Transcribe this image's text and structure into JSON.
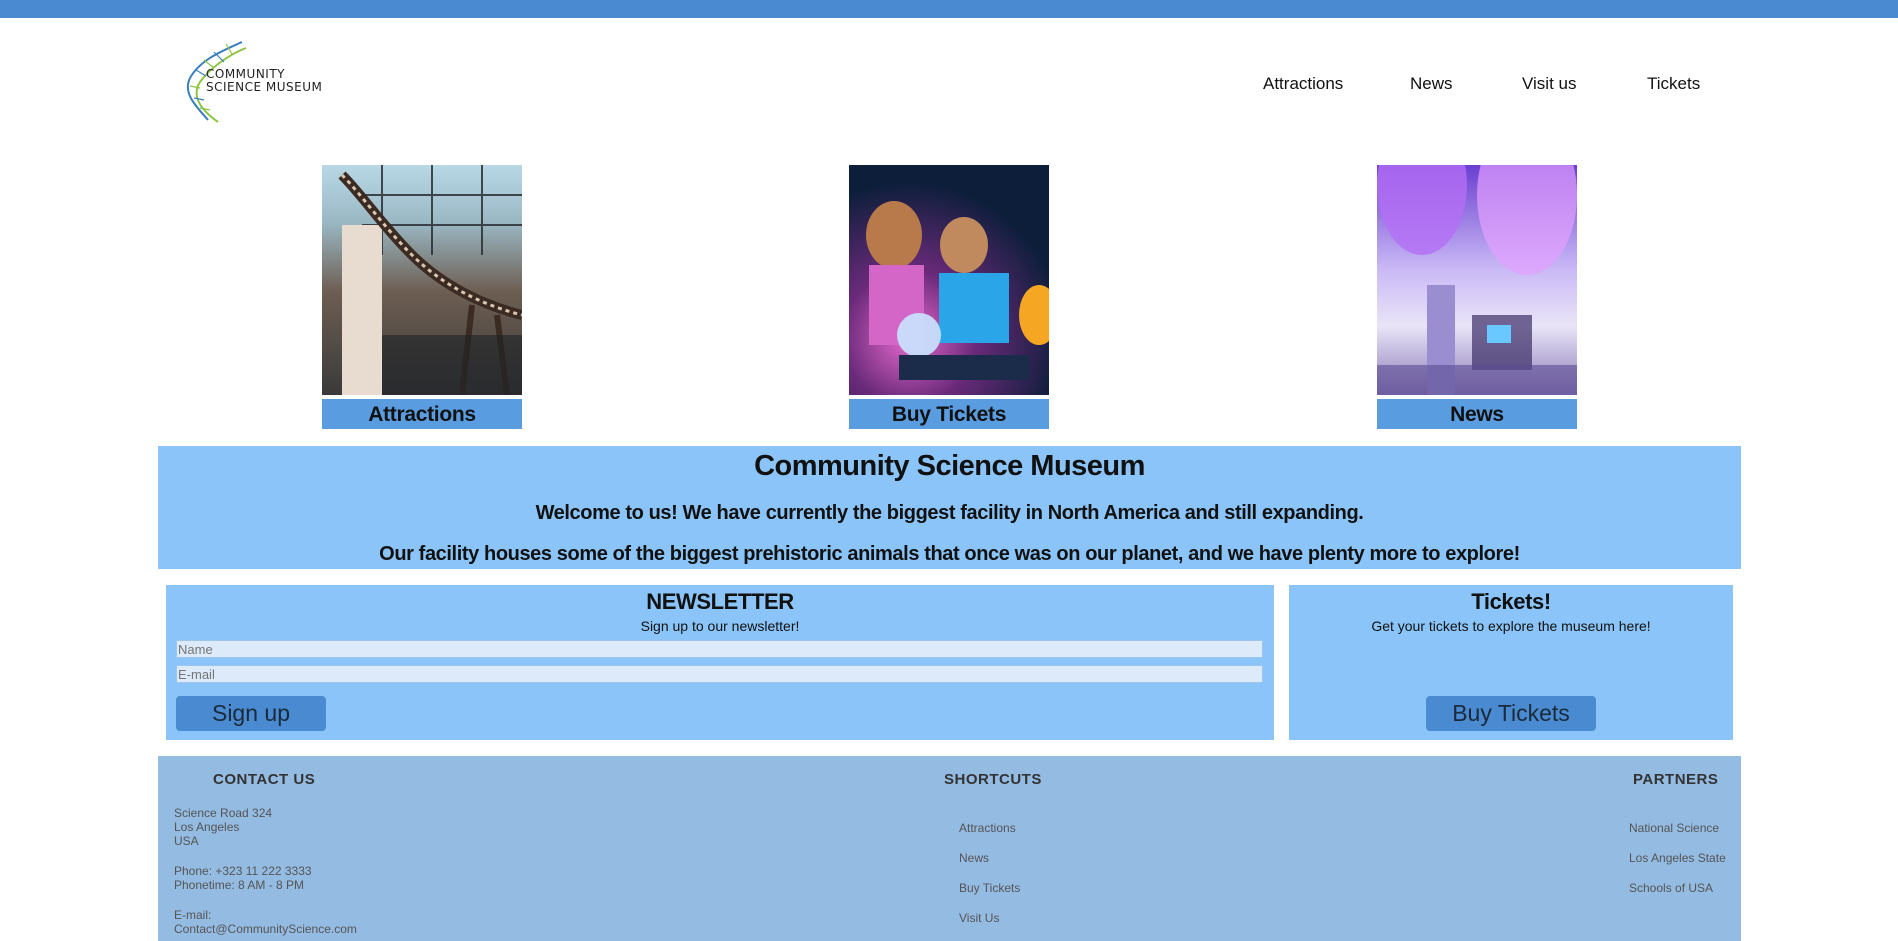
{
  "header": {
    "logo_line1": "COMMUNITY",
    "logo_line2": "SCIENCE MUSEUM",
    "nav": [
      "Attractions",
      "News",
      "Visit us",
      "Tickets"
    ]
  },
  "cards": [
    {
      "label": "Attractions"
    },
    {
      "label": "Buy Tickets"
    },
    {
      "label": "News"
    }
  ],
  "hero": {
    "title": "Community Science Museum",
    "line1": "Welcome to us! We have currently the biggest facility in North America and still expanding.",
    "line2": "Our facility houses some of the biggest prehistoric animals that once was on our planet, and we have plenty more to explore!"
  },
  "newsletter": {
    "title": "NEWSLETTER",
    "subtitle": "Sign up to our newsletter!",
    "name_placeholder": "Name",
    "email_placeholder": "E-mail",
    "button": "Sign up"
  },
  "tickets": {
    "title": "Tickets!",
    "subtitle": "Get your tickets to explore the museum here!",
    "button": "Buy Tickets"
  },
  "footer": {
    "contact_title": "CONTACT US",
    "address1": "Science Road 324",
    "address2": "Los Angeles",
    "address3": "USA",
    "phone": "Phone: +323 11 222 3333",
    "phonetime": "Phonetime: 8 AM - 8 PM",
    "email_label": "E-mail:",
    "email": "Contact@CommunityScience.com",
    "shortcuts_title": "SHORTCUTS",
    "shortcuts": [
      "Attractions",
      "News",
      "Buy Tickets",
      "Visit Us"
    ],
    "partners_title": "PARTNERS",
    "partners": [
      "National Science",
      "Los Angeles State",
      "Schools of USA"
    ]
  },
  "colors": {
    "topbar": "#4a8ad0",
    "caption": "#5a9ce0",
    "panel": "#8ac4f8",
    "footer": "#94bbe2",
    "button": "#4a8ad0"
  }
}
